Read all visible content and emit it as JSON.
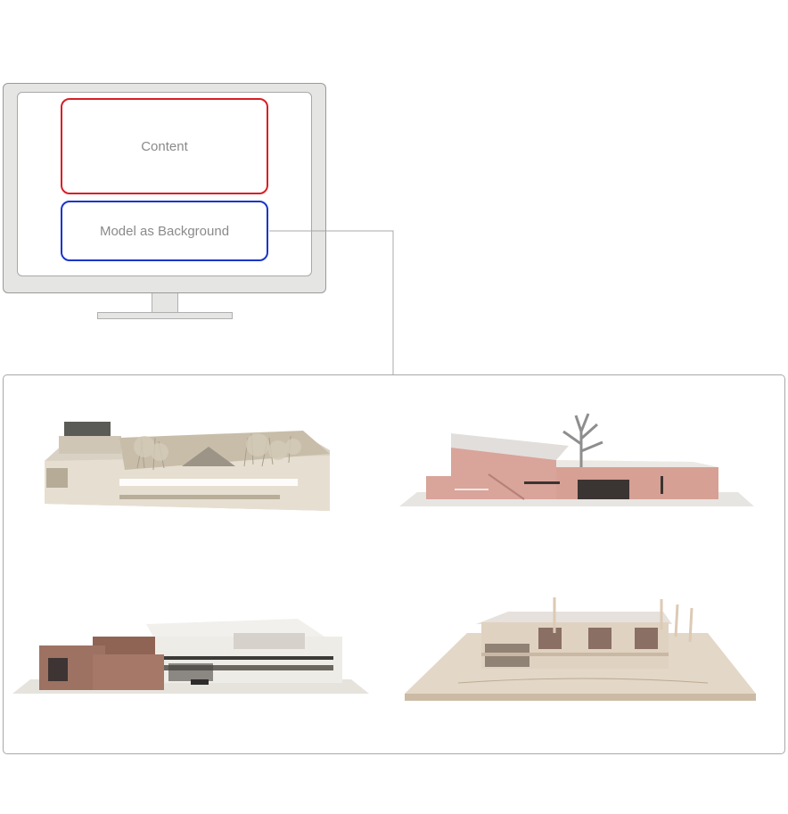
{
  "diagram": {
    "content_label": "Content",
    "model_label": "Model as Background"
  },
  "colors": {
    "content_border": "#d81f26",
    "model_border": "#1a35c9",
    "monitor_fill": "#e5e5e3",
    "connector": "#a8a8a8"
  },
  "models": [
    {
      "name": "courtyard-building-model",
      "material": "white-card"
    },
    {
      "name": "pink-gallery-model-with-tree",
      "material": "pink-card"
    },
    {
      "name": "brick-and-white-complex-model",
      "material": "brick-white"
    },
    {
      "name": "three-window-pavilion-model",
      "material": "wood-card"
    }
  ]
}
